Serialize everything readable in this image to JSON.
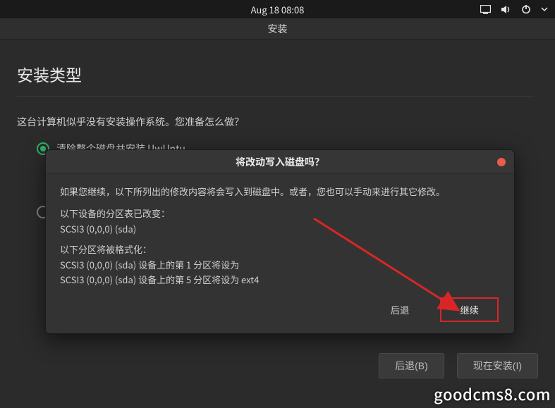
{
  "topbar": {
    "datetime": "Aug 18  08:08"
  },
  "window": {
    "title": "安装"
  },
  "page": {
    "title": "安装类型",
    "question": "这台计算机似乎没有安装操作系统。您准备怎么做？",
    "radios": [
      {
        "label": "清除整个磁盘并安装 UwUntu",
        "selected": true
      },
      {
        "label": "",
        "selected": false
      }
    ],
    "hidden_half": "您"
  },
  "modal": {
    "title": "将改动写入磁盘吗？",
    "intro": "如果您继续，以下所列出的修改内容将会写入到磁盘中。或者，您也可以手动来进行其它修改。",
    "partition_table_header": "以下设备的分区表已改变：",
    "partition_table_items": [
      "SCSI3 (0,0,0) (sda)"
    ],
    "format_header": "以下分区将被格式化：",
    "format_items": [
      "SCSI3 (0,0,0) (sda) 设备上的第 1 分区将设为",
      "SCSI3 (0,0,0) (sda) 设备上的第 5 分区将设为 ext4"
    ],
    "back_label": "后退",
    "continue_label": "继续"
  },
  "footer": {
    "back_label": "后退(B)",
    "install_label": "现在安装(I)"
  },
  "watermark": "goodcms8.com"
}
